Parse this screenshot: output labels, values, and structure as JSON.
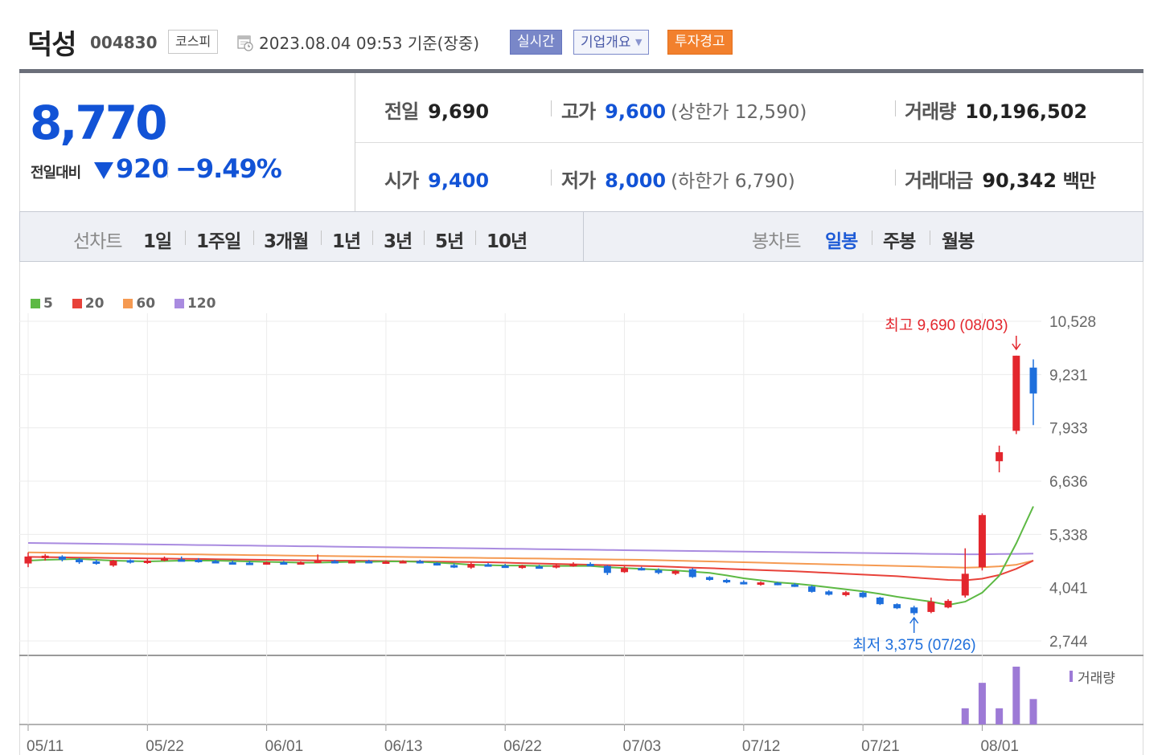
{
  "header": {
    "stock_name": "덕성",
    "stock_code": "004830",
    "market": "코스피",
    "datetime": "2023.08.04 09:53",
    "basis": "기준(장중)",
    "realtime_label": "실시간",
    "company_overview_label": "기업개요",
    "warning_label": "투자경고"
  },
  "price": {
    "current": "8,770",
    "change_label": "전일대비",
    "change_value": "920",
    "change_percent": "−9.49%",
    "direction": "down",
    "prev_close_label": "전일",
    "prev_close": "9,690",
    "high_label": "고가",
    "high": "9,600",
    "upper_limit": "(상한가 12,590)",
    "volume_label": "거래량",
    "volume": "10,196,502",
    "open_label": "시가",
    "open": "9,400",
    "low_label": "저가",
    "low": "8,000",
    "lower_limit": "(하한가 6,790)",
    "value_label": "거래대금",
    "trade_value": "90,342",
    "trade_value_unit": "백만"
  },
  "tabs": {
    "line_chart_label": "선차트",
    "line_periods": [
      "1일",
      "1주일",
      "3개월",
      "1년",
      "3년",
      "5년",
      "10년"
    ],
    "candle_chart_label": "봉차트",
    "candle_periods": [
      "일봉",
      "주봉",
      "월봉"
    ],
    "selected_candle": "일봉"
  },
  "colors": {
    "up": "#e3262d",
    "down": "#1e6fdc",
    "ma5": "#5db944",
    "ma20": "#e8423a",
    "ma60": "#f59a52",
    "ma120": "#a98be0",
    "volume": "#9d7ad6"
  },
  "chart_data": {
    "type": "candlestick",
    "y_ticks": [
      "10,528",
      "9,231",
      "7,933",
      "6,636",
      "5,338",
      "4,041",
      "2,744"
    ],
    "ylim": [
      2744,
      10528
    ],
    "x_tick_labels": [
      "05/11",
      "05/22",
      "06/01",
      "06/13",
      "06/22",
      "07/03",
      "07/12",
      "07/21",
      "08/01"
    ],
    "legend": [
      {
        "name": "5",
        "color": "#5db944"
      },
      {
        "name": "20",
        "color": "#e8423a"
      },
      {
        "name": "60",
        "color": "#f59a52"
      },
      {
        "name": "120",
        "color": "#a98be0"
      }
    ],
    "max_annotation": "최고 9,690 (08/03)",
    "min_annotation": "최저 3,375 (07/26)",
    "volume_label": "거래량",
    "candles": [
      {
        "d": "05/11",
        "o": 4630,
        "h": 4900,
        "l": 4540,
        "c": 4800
      },
      {
        "d": "05/12",
        "o": 4760,
        "h": 4860,
        "l": 4700,
        "c": 4820
      },
      {
        "d": "05/15",
        "o": 4800,
        "h": 4830,
        "l": 4680,
        "c": 4720
      },
      {
        "d": "05/16",
        "o": 4730,
        "h": 4760,
        "l": 4620,
        "c": 4660
      },
      {
        "d": "05/17",
        "o": 4680,
        "h": 4720,
        "l": 4600,
        "c": 4640
      },
      {
        "d": "05/18",
        "o": 4580,
        "h": 4720,
        "l": 4550,
        "c": 4700
      },
      {
        "d": "05/19",
        "o": 4710,
        "h": 4730,
        "l": 4630,
        "c": 4660
      },
      {
        "d": "05/22",
        "o": 4680,
        "h": 4740,
        "l": 4620,
        "c": 4700
      },
      {
        "d": "05/23",
        "o": 4710,
        "h": 4800,
        "l": 4680,
        "c": 4760
      },
      {
        "d": "05/24",
        "o": 4730,
        "h": 4800,
        "l": 4690,
        "c": 4720
      },
      {
        "d": "05/25",
        "o": 4720,
        "h": 4760,
        "l": 4650,
        "c": 4680
      },
      {
        "d": "05/26",
        "o": 4690,
        "h": 4720,
        "l": 4640,
        "c": 4670
      },
      {
        "d": "05/30",
        "o": 4660,
        "h": 4700,
        "l": 4620,
        "c": 4640
      },
      {
        "d": "05/31",
        "o": 4650,
        "h": 4690,
        "l": 4600,
        "c": 4630
      },
      {
        "d": "06/01",
        "o": 4620,
        "h": 4680,
        "l": 4600,
        "c": 4660
      },
      {
        "d": "06/02",
        "o": 4660,
        "h": 4690,
        "l": 4620,
        "c": 4640
      },
      {
        "d": "06/05",
        "o": 4650,
        "h": 4680,
        "l": 4620,
        "c": 4660
      },
      {
        "d": "06/07",
        "o": 4660,
        "h": 4850,
        "l": 4640,
        "c": 4700
      },
      {
        "d": "06/08",
        "o": 4690,
        "h": 4720,
        "l": 4650,
        "c": 4670
      },
      {
        "d": "06/09",
        "o": 4670,
        "h": 4710,
        "l": 4640,
        "c": 4690
      },
      {
        "d": "06/12",
        "o": 4690,
        "h": 4720,
        "l": 4650,
        "c": 4680
      },
      {
        "d": "06/13",
        "o": 4670,
        "h": 4700,
        "l": 4640,
        "c": 4680
      },
      {
        "d": "06/14",
        "o": 4680,
        "h": 4710,
        "l": 4650,
        "c": 4690
      },
      {
        "d": "06/15",
        "o": 4690,
        "h": 4720,
        "l": 4630,
        "c": 4640
      },
      {
        "d": "06/16",
        "o": 4640,
        "h": 4660,
        "l": 4580,
        "c": 4600
      },
      {
        "d": "06/19",
        "o": 4590,
        "h": 4630,
        "l": 4520,
        "c": 4540
      },
      {
        "d": "06/20",
        "o": 4530,
        "h": 4650,
        "l": 4500,
        "c": 4620
      },
      {
        "d": "06/21",
        "o": 4610,
        "h": 4640,
        "l": 4560,
        "c": 4580
      },
      {
        "d": "06/22",
        "o": 4580,
        "h": 4620,
        "l": 4540,
        "c": 4560
      },
      {
        "d": "06/23",
        "o": 4550,
        "h": 4600,
        "l": 4500,
        "c": 4580
      },
      {
        "d": "06/26",
        "o": 4560,
        "h": 4600,
        "l": 4520,
        "c": 4550
      },
      {
        "d": "06/27",
        "o": 4540,
        "h": 4620,
        "l": 4510,
        "c": 4590
      },
      {
        "d": "06/28",
        "o": 4570,
        "h": 4660,
        "l": 4550,
        "c": 4620
      },
      {
        "d": "06/29",
        "o": 4620,
        "h": 4660,
        "l": 4560,
        "c": 4580
      },
      {
        "d": "06/30",
        "o": 4570,
        "h": 4590,
        "l": 4350,
        "c": 4400
      },
      {
        "d": "07/03",
        "o": 4420,
        "h": 4560,
        "l": 4400,
        "c": 4520
      },
      {
        "d": "07/04",
        "o": 4520,
        "h": 4550,
        "l": 4460,
        "c": 4480
      },
      {
        "d": "07/05",
        "o": 4470,
        "h": 4510,
        "l": 4370,
        "c": 4400
      },
      {
        "d": "07/06",
        "o": 4380,
        "h": 4470,
        "l": 4350,
        "c": 4450
      },
      {
        "d": "07/07",
        "o": 4490,
        "h": 4520,
        "l": 4280,
        "c": 4300
      },
      {
        "d": "07/10",
        "o": 4300,
        "h": 4320,
        "l": 4210,
        "c": 4230
      },
      {
        "d": "07/11",
        "o": 4230,
        "h": 4260,
        "l": 4150,
        "c": 4170
      },
      {
        "d": "07/12",
        "o": 4180,
        "h": 4220,
        "l": 4120,
        "c": 4150
      },
      {
        "d": "07/13",
        "o": 4150,
        "h": 4190,
        "l": 4090,
        "c": 4170
      },
      {
        "d": "07/14",
        "o": 4160,
        "h": 4180,
        "l": 4100,
        "c": 4120
      },
      {
        "d": "07/17",
        "o": 4120,
        "h": 4150,
        "l": 4060,
        "c": 4080
      },
      {
        "d": "07/18",
        "o": 4070,
        "h": 4100,
        "l": 3920,
        "c": 3940
      },
      {
        "d": "07/19",
        "o": 3950,
        "h": 3980,
        "l": 3850,
        "c": 3870
      },
      {
        "d": "07/20",
        "o": 3860,
        "h": 3960,
        "l": 3830,
        "c": 3930
      },
      {
        "d": "07/21",
        "o": 3920,
        "h": 3950,
        "l": 3790,
        "c": 3810
      },
      {
        "d": "07/24",
        "o": 3800,
        "h": 3820,
        "l": 3620,
        "c": 3640
      },
      {
        "d": "07/25",
        "o": 3640,
        "h": 3660,
        "l": 3520,
        "c": 3540
      },
      {
        "d": "07/26",
        "o": 3560,
        "h": 3600,
        "l": 3375,
        "c": 3420
      },
      {
        "d": "07/27",
        "o": 3450,
        "h": 3800,
        "l": 3420,
        "c": 3700
      },
      {
        "d": "07/28",
        "o": 3560,
        "h": 3760,
        "l": 3540,
        "c": 3720
      },
      {
        "d": "07/31",
        "o": 3850,
        "h": 5000,
        "l": 3800,
        "c": 4380
      },
      {
        "d": "08/01",
        "o": 4540,
        "h": 5850,
        "l": 4460,
        "c": 5810
      },
      {
        "d": "08/02",
        "o": 7120,
        "h": 7500,
        "l": 6850,
        "c": 7340
      },
      {
        "d": "08/03",
        "o": 7860,
        "h": 9690,
        "l": 7780,
        "c": 9690
      },
      {
        "d": "08/04",
        "o": 9400,
        "h": 9600,
        "l": 8000,
        "c": 8770
      }
    ],
    "volume": [
      0,
      0,
      0,
      0,
      0,
      0,
      0,
      0,
      0,
      0,
      0,
      0,
      0,
      0,
      0,
      0,
      0,
      0,
      0,
      0,
      0,
      0,
      0,
      0,
      0,
      0,
      0,
      0,
      0,
      0,
      0,
      0,
      0,
      0,
      0,
      0,
      0,
      0,
      0,
      0,
      0,
      0,
      0,
      0,
      0,
      0,
      0,
      0,
      0,
      0,
      0,
      0,
      0,
      0,
      0,
      7,
      18,
      7,
      25,
      11
    ],
    "ma5": [
      4700,
      4720,
      4730,
      4740,
      4720,
      4700,
      4690,
      4680,
      4690,
      4700,
      4700,
      4700,
      4690,
      4680,
      4670,
      4660,
      4650,
      4650,
      4660,
      4670,
      4670,
      4680,
      4680,
      4670,
      4650,
      4630,
      4600,
      4590,
      4580,
      4580,
      4570,
      4570,
      4570,
      4570,
      4540,
      4520,
      4500,
      4480,
      4460,
      4430,
      4400,
      4340,
      4270,
      4220,
      4170,
      4140,
      4100,
      4050,
      4000,
      3950,
      3890,
      3820,
      3760,
      3700,
      3620,
      3700,
      3920,
      4330,
      5120,
      6020
    ],
    "ma20": [
      4790,
      4785,
      4780,
      4775,
      4770,
      4765,
      4760,
      4755,
      4750,
      4745,
      4740,
      4735,
      4730,
      4725,
      4720,
      4715,
      4710,
      4705,
      4700,
      4700,
      4695,
      4690,
      4685,
      4680,
      4675,
      4670,
      4665,
      4660,
      4650,
      4640,
      4630,
      4620,
      4610,
      4600,
      4590,
      4580,
      4570,
      4560,
      4545,
      4530,
      4515,
      4500,
      4485,
      4470,
      4455,
      4440,
      4420,
      4400,
      4380,
      4360,
      4340,
      4320,
      4290,
      4260,
      4230,
      4220,
      4260,
      4350,
      4500,
      4700
    ],
    "ma60": [
      4900,
      4895,
      4890,
      4885,
      4880,
      4875,
      4870,
      4865,
      4860,
      4855,
      4850,
      4845,
      4840,
      4835,
      4830,
      4825,
      4820,
      4815,
      4810,
      4805,
      4800,
      4795,
      4790,
      4785,
      4780,
      4775,
      4770,
      4765,
      4760,
      4755,
      4750,
      4745,
      4740,
      4735,
      4730,
      4725,
      4720,
      4710,
      4700,
      4690,
      4680,
      4670,
      4660,
      4650,
      4640,
      4630,
      4620,
      4610,
      4600,
      4590,
      4580,
      4570,
      4560,
      4550,
      4540,
      4530,
      4540,
      4560,
      4600,
      4700
    ],
    "ma120": [
      5130,
      5125,
      5120,
      5115,
      5110,
      5105,
      5100,
      5095,
      5090,
      5085,
      5080,
      5075,
      5070,
      5065,
      5060,
      5055,
      5050,
      5045,
      5040,
      5035,
      5030,
      5025,
      5020,
      5015,
      5010,
      5005,
      5000,
      4995,
      4990,
      4985,
      4980,
      4975,
      4970,
      4965,
      4960,
      4955,
      4950,
      4945,
      4940,
      4935,
      4930,
      4925,
      4920,
      4915,
      4910,
      4905,
      4900,
      4895,
      4890,
      4885,
      4880,
      4875,
      4870,
      4865,
      4860,
      4855,
      4855,
      4860,
      4865,
      4870
    ]
  }
}
